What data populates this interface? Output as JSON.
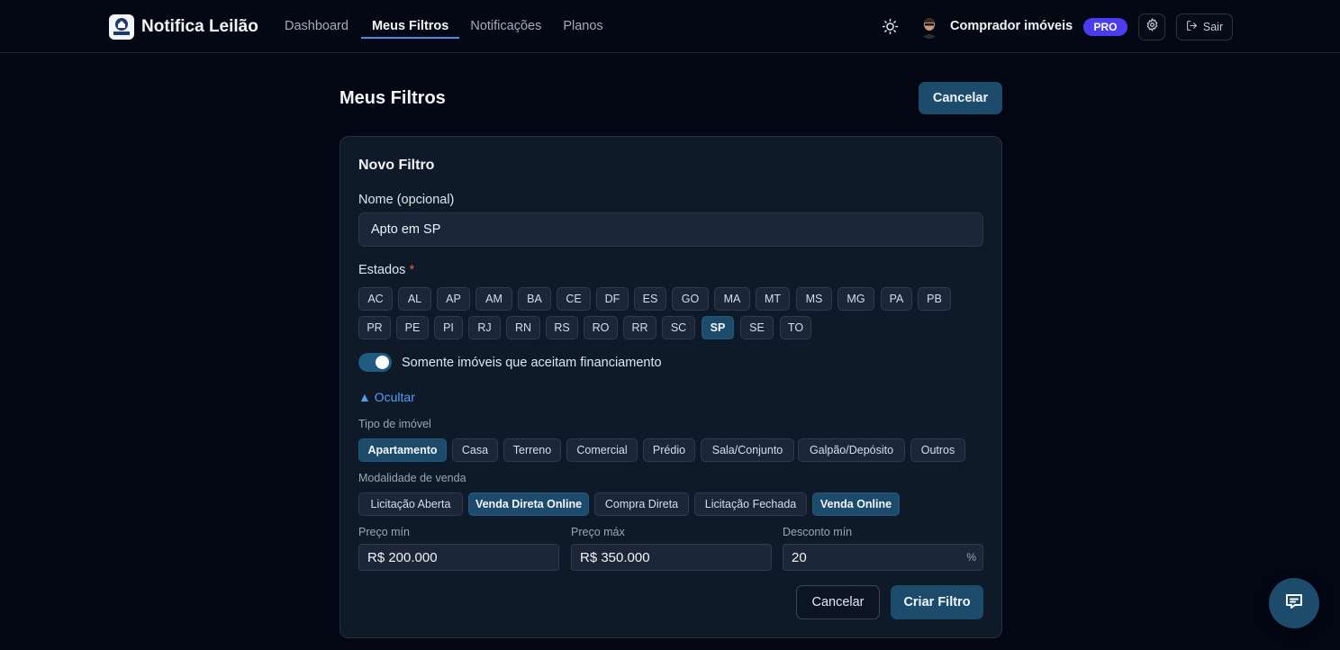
{
  "header": {
    "brand": "Notifica Leilão",
    "logo_text": "NOTIFICA LEILÃO",
    "nav": [
      "Dashboard",
      "Meus Filtros",
      "Notificações",
      "Planos"
    ],
    "active_nav": "Meus Filtros",
    "user_name": "Comprador imóveis",
    "plan_badge": "PRO",
    "logout_label": "Sair"
  },
  "page": {
    "title": "Meus Filtros",
    "cancel_label": "Cancelar"
  },
  "form": {
    "title": "Novo Filtro",
    "name_label": "Nome (opcional)",
    "name_value": "Apto em SP",
    "states_label": "Estados",
    "required_mark": "*",
    "states": [
      "AC",
      "AL",
      "AP",
      "AM",
      "BA",
      "CE",
      "DF",
      "ES",
      "GO",
      "MA",
      "MT",
      "MS",
      "MG",
      "PA",
      "PB",
      "PR",
      "PE",
      "PI",
      "RJ",
      "RN",
      "RS",
      "RO",
      "RR",
      "SC",
      "SP",
      "SE",
      "TO"
    ],
    "selected_states": [
      "SP"
    ],
    "financing_label": "Somente imóveis que aceitam financiamento",
    "financing_on": true,
    "hide_link": "▲ Ocultar",
    "property_type_label": "Tipo de imóvel",
    "property_types": [
      "Apartamento",
      "Casa",
      "Terreno",
      "Comercial",
      "Prédio",
      "Sala/Conjunto",
      "Galpão/Depósito",
      "Outros"
    ],
    "selected_property_types": [
      "Apartamento"
    ],
    "sale_mode_label": "Modalidade de venda",
    "sale_modes": [
      "Licitação Aberta",
      "Venda Direta Online",
      "Compra Direta",
      "Licitação Fechada",
      "Venda Online"
    ],
    "selected_sale_modes": [
      "Venda Direta Online",
      "Venda Online"
    ],
    "price_min_label": "Preço mín",
    "price_min_value": "R$ 200.000",
    "price_max_label": "Preço máx",
    "price_max_value": "R$ 350.000",
    "discount_label": "Desconto mín",
    "discount_value": "20",
    "discount_unit": "%",
    "cancel_label": "Cancelar",
    "submit_label": "Criar Filtro"
  },
  "colors": {
    "accent": "#1d4b6c",
    "badge": "#4b3cf0",
    "link": "#5b9df0"
  }
}
